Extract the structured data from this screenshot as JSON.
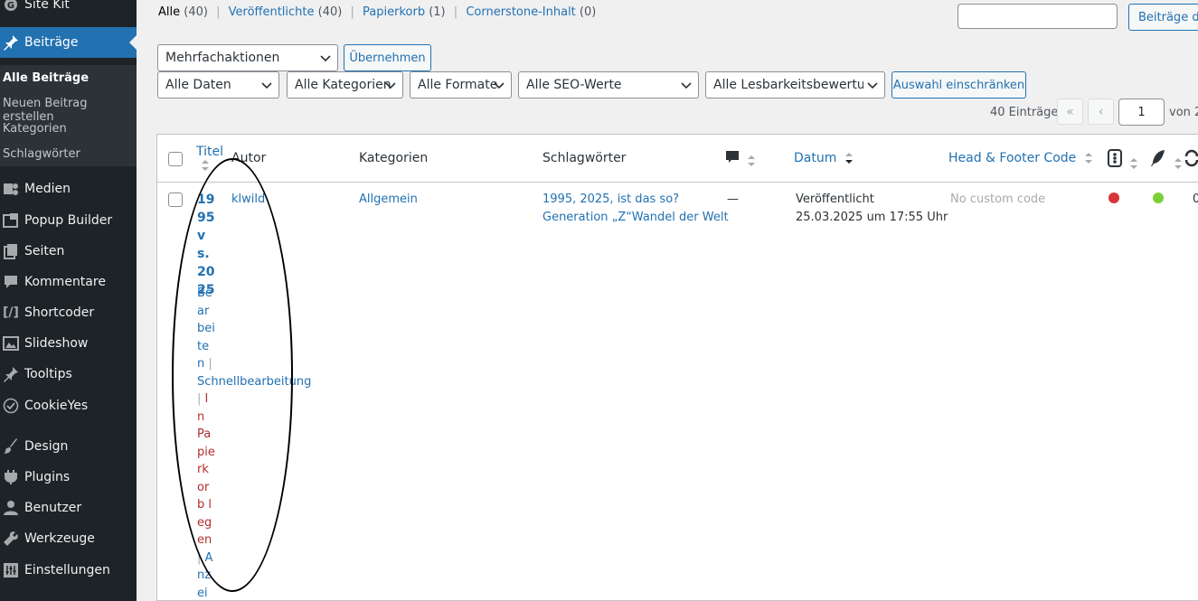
{
  "sidebar": {
    "top_item": "Site Kit",
    "active_item": "Beiträge",
    "submenu": [
      "Alle Beiträge",
      "Neuen Beitrag erstellen",
      "Kategorien",
      "Schlagwörter"
    ],
    "items": [
      "Medien",
      "Popup Builder",
      "Seiten",
      "Kommentare",
      "Shortcoder",
      "Slideshow",
      "Tooltips",
      "CookieYes",
      "Design",
      "Plugins",
      "Benutzer",
      "Werkzeuge",
      "Einstellungen"
    ],
    "colors": {
      "bg": "#1d2327",
      "active": "#2271b1"
    }
  },
  "views": {
    "all": "Alle",
    "all_count": "(40)",
    "published": "Veröffentlichte",
    "published_count": "(40)",
    "trash": "Papierkorb",
    "trash_count": "(1)",
    "cornerstone": "Cornerstone-Inhalt",
    "cornerstone_count": "(0)"
  },
  "search": {
    "value": "",
    "button": "Beiträge du"
  },
  "bulk": {
    "select": "Mehrfachaktionen",
    "apply": "Übernehmen"
  },
  "filters": {
    "dates": "Alle Daten",
    "categories": "Alle Kategorien",
    "formats": "Alle Formate",
    "seo": "Alle SEO-Werte",
    "readability": "Alle Lesbarkeitsbewertunge",
    "submit": "Auswahl einschränken"
  },
  "pagination": {
    "count": "40 Einträge",
    "first": "«",
    "prev": "‹",
    "current": "1",
    "of": "von 2"
  },
  "table": {
    "headers": {
      "title": "Titel",
      "author": "Autor",
      "categories": "Kategorien",
      "tags": "Schlagwörter",
      "date": "Datum",
      "hfcode": "Head & Footer Code"
    },
    "row": {
      "title": "1995 vs. 2025",
      "author": "klwild",
      "category": "Allgemein",
      "tags_line1": "1995, 2025, ist das so?",
      "tags_line2": "Generation „Z“Wandel der Welt",
      "comments": "—",
      "status": "Veröffentlicht",
      "date": "25.03.2025 um 17:55 Uhr",
      "hfcode": "No custom code",
      "seo_color": "#d63638",
      "readability_color": "#7ad03a",
      "last": "0",
      "actions": {
        "edit": "Bearbeiten",
        "quick": "Schnellbearbeitung",
        "trash": "In Papierkorb legen",
        "view": "Anzei"
      }
    }
  }
}
